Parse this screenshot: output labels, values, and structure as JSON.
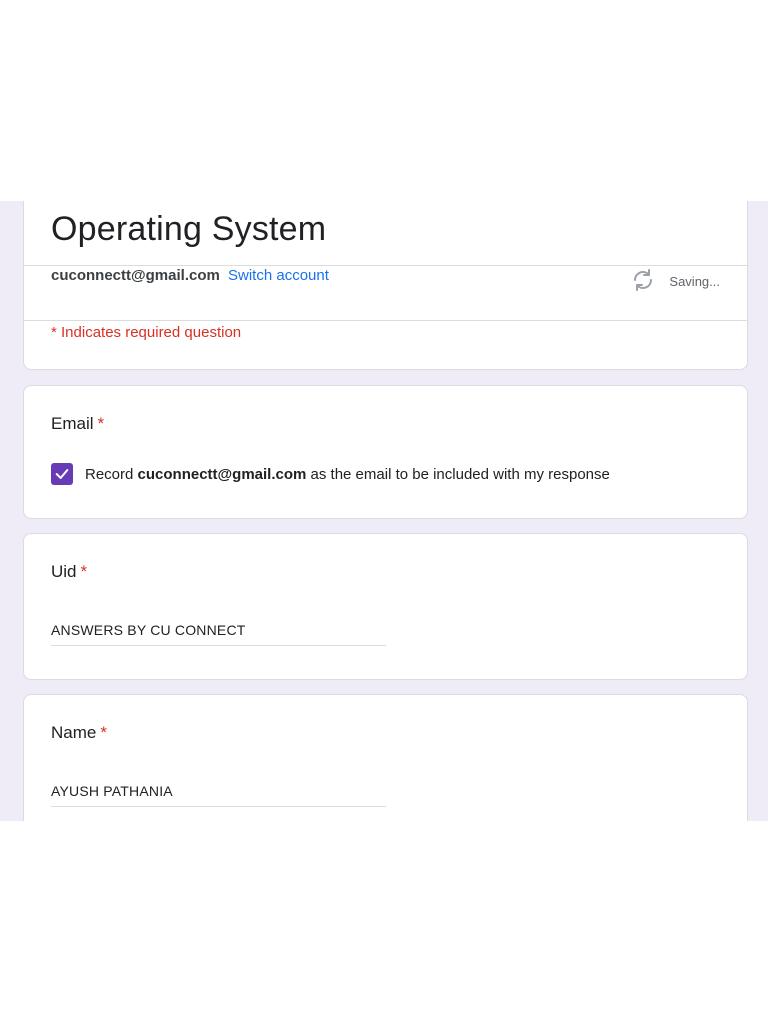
{
  "form": {
    "title": "Operating System",
    "account_email": "cuconnectt@gmail.com",
    "switch_account_label": "Switch account",
    "saving_status": "Saving...",
    "required_note": "* Indicates required question"
  },
  "questions": {
    "email": {
      "label": "Email",
      "required_mark": "*",
      "checkbox_checked": true,
      "checkbox_prefix": "Record",
      "checkbox_email": "cuconnectt@gmail.com",
      "checkbox_suffix": "as the email to be included with my response"
    },
    "uid": {
      "label": "Uid",
      "required_mark": "*",
      "value": "ANSWERS BY CU CONNECT"
    },
    "name": {
      "label": "Name",
      "required_mark": "*",
      "value": "AYUSH PATHANIA"
    }
  },
  "colors": {
    "accent": "#673ab7",
    "link": "#1a73e8",
    "required": "#d93025",
    "background": "#efebf7"
  },
  "icons": {
    "saving": "sync-icon",
    "checkbox": "checkmark-icon"
  }
}
